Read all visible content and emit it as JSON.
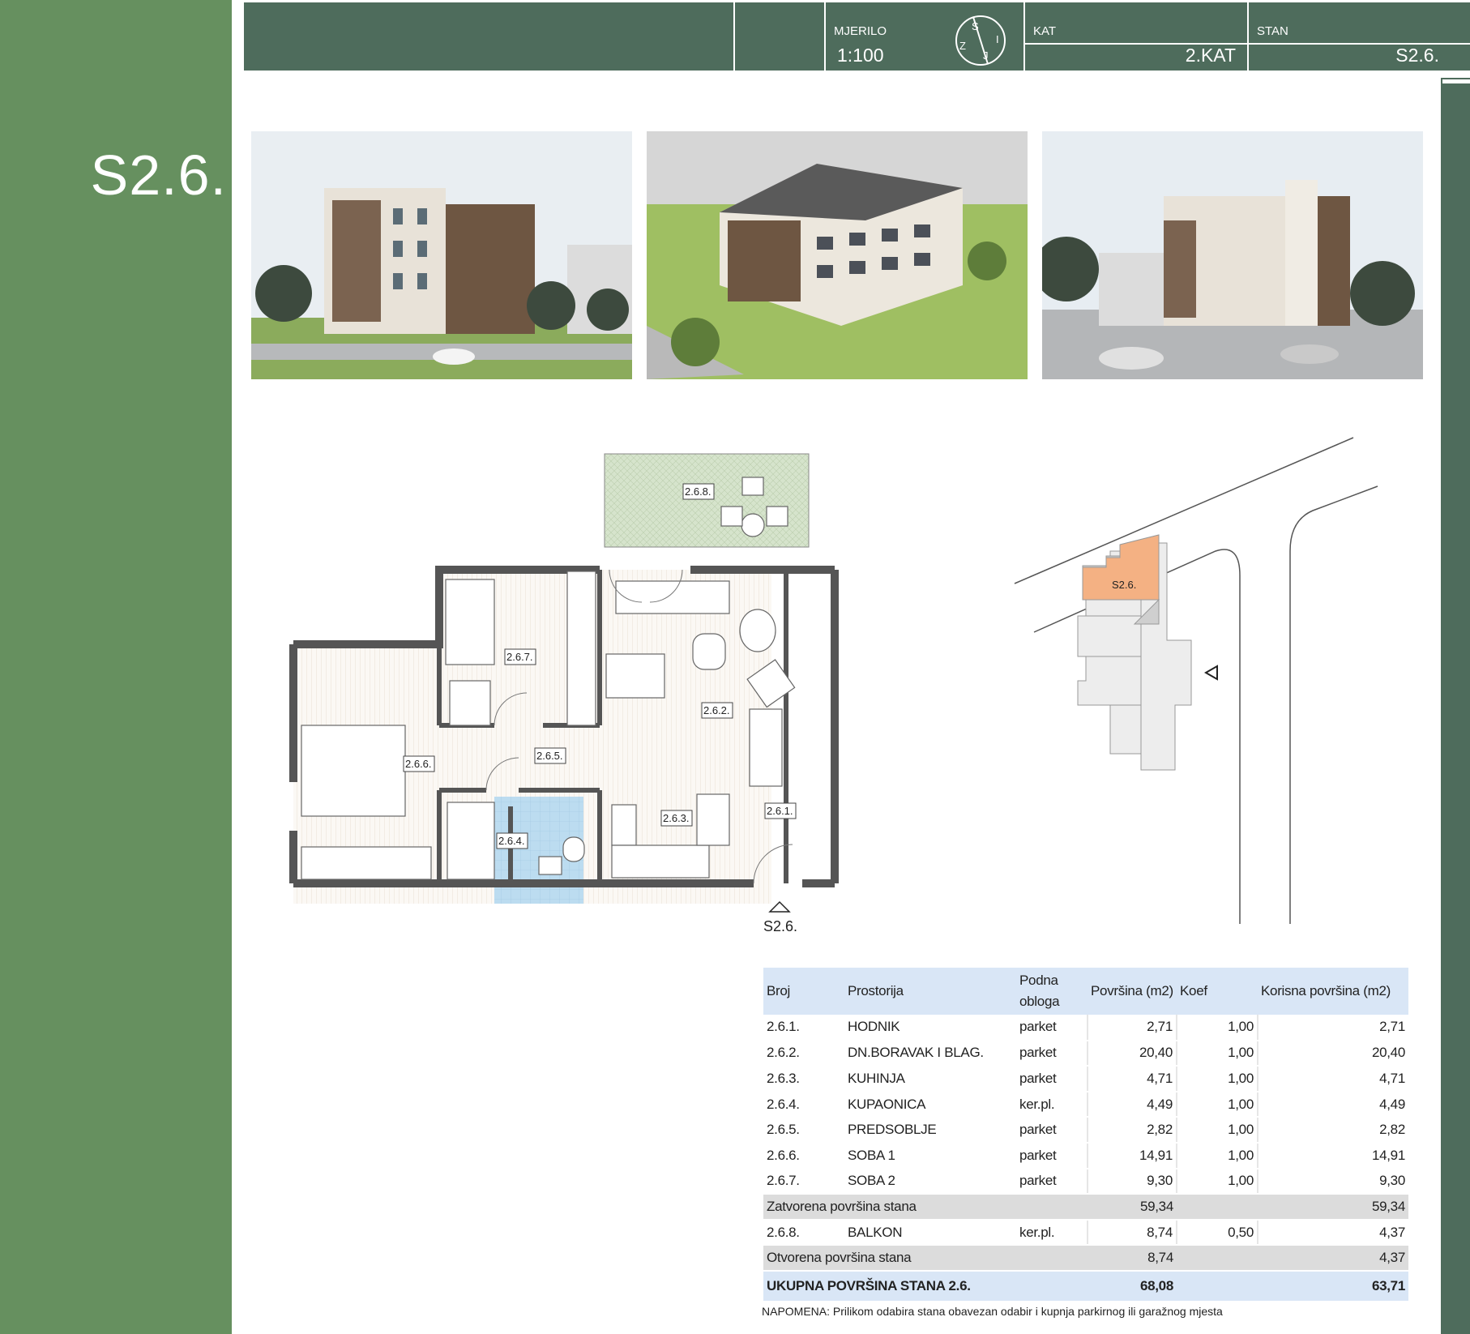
{
  "apartment_label": "S2.6.",
  "header": {
    "scale_label": "MJERILO",
    "scale_value": "1:100",
    "compass": {
      "n": "S",
      "e": "I",
      "s": "J",
      "w": "Z"
    },
    "floor_label": "KAT",
    "floor_value": "2.KAT",
    "unit_label": "STAN",
    "unit_value": "S2.6."
  },
  "floor_plan": {
    "rooms": [
      {
        "id": "2.6.1."
      },
      {
        "id": "2.6.2."
      },
      {
        "id": "2.6.3."
      },
      {
        "id": "2.6.4."
      },
      {
        "id": "2.6.5."
      },
      {
        "id": "2.6.6."
      },
      {
        "id": "2.6.7."
      },
      {
        "id": "2.6.8."
      }
    ],
    "entrance_label": "S2.6."
  },
  "site_plan": {
    "unit_label": "S2.6."
  },
  "table": {
    "headers": [
      "Broj",
      "Prostorija",
      "Podna obloga",
      "Površina (m2)",
      "Koef",
      "Korisna površina (m2)"
    ],
    "rows": [
      {
        "no": "2.6.1.",
        "room": "HODNIK",
        "floor": "parket",
        "area": "2,71",
        "coef": "1,00",
        "usable": "2,71"
      },
      {
        "no": "2.6.2.",
        "room": "DN.BORAVAK I BLAG.",
        "floor": "parket",
        "area": "20,40",
        "coef": "1,00",
        "usable": "20,40"
      },
      {
        "no": "2.6.3.",
        "room": "KUHINJA",
        "floor": "parket",
        "area": "4,71",
        "coef": "1,00",
        "usable": "4,71"
      },
      {
        "no": "2.6.4.",
        "room": "KUPAONICA",
        "floor": "ker.pl.",
        "area": "4,49",
        "coef": "1,00",
        "usable": "4,49"
      },
      {
        "no": "2.6.5.",
        "room": "PREDSOBLJE",
        "floor": "parket",
        "area": "2,82",
        "coef": "1,00",
        "usable": "2,82"
      },
      {
        "no": "2.6.6.",
        "room": "SOBA 1",
        "floor": "parket",
        "area": "14,91",
        "coef": "1,00",
        "usable": "14,91"
      },
      {
        "no": "2.6.7.",
        "room": "SOBA 2",
        "floor": "parket",
        "area": "9,30",
        "coef": "1,00",
        "usable": "9,30"
      }
    ],
    "closed_total": {
      "label": "Zatvorena površina stana",
      "area": "59,34",
      "usable": "59,34"
    },
    "open_rows": [
      {
        "no": "2.6.8.",
        "room": "BALKON",
        "floor": "ker.pl.",
        "area": "8,74",
        "coef": "0,50",
        "usable": "4,37"
      }
    ],
    "open_total": {
      "label": "Otvorena površina stana",
      "area": "8,74",
      "usable": "4,37"
    },
    "grand_total": {
      "label": "UKUPNA POVRŠINA STANA 2.6.",
      "area": "68,08",
      "usable": "63,71"
    }
  },
  "note": "NAPOMENA: Prilikom odabira stana obavezan odabir i kupnja parkirnog ili garažnog mjesta",
  "colors": {
    "side_band": "#66905f",
    "header": "#4e6c5c",
    "unit_highlight": "#f4b183",
    "balcony": "#d6e4cc",
    "bathroom": "#bcdcf0",
    "table_header": "#d9e6f6"
  }
}
